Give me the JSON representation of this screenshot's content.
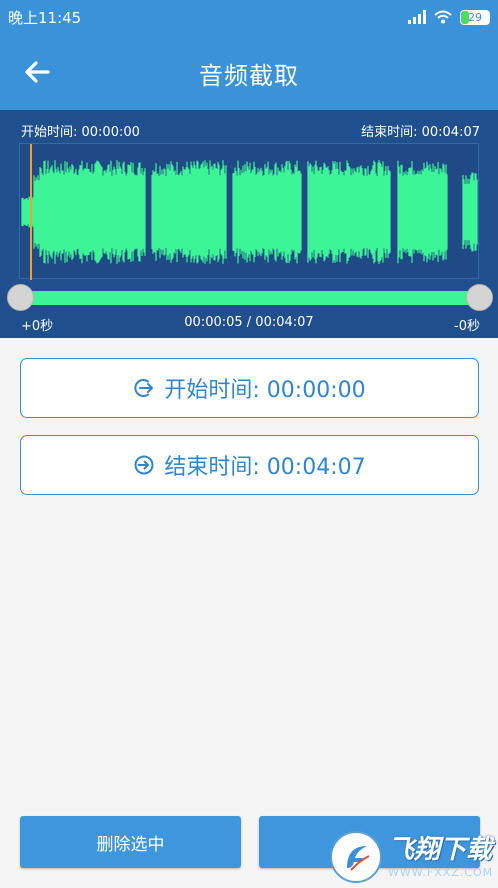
{
  "status_bar": {
    "time": "晚上11:45",
    "battery": "29",
    "icons": [
      "signal-icon",
      "wifi-icon",
      "battery-icon"
    ]
  },
  "app_bar": {
    "title": "音频截取",
    "back_icon": "arrow-left-icon"
  },
  "editor": {
    "start_label": "开始时间: 00:00:00",
    "end_label": "结束时间: 00:04:07",
    "left_offset": "+0秒",
    "position": "00:00:05 / 00:04:07",
    "right_offset": "-0秒",
    "waveform_color": "#3df596",
    "background_color": "#1f4f8c"
  },
  "buttons": {
    "start_time": "开始时间: 00:00:00",
    "end_time": "结束时间: 00:04:07",
    "delete_selected": "删除选中"
  },
  "watermark": {
    "main": "飞翔下载",
    "sub": "WWW.FXXZ.COM"
  },
  "colors": {
    "primary": "#3a93d8",
    "accent_text": "#2f86cf"
  }
}
